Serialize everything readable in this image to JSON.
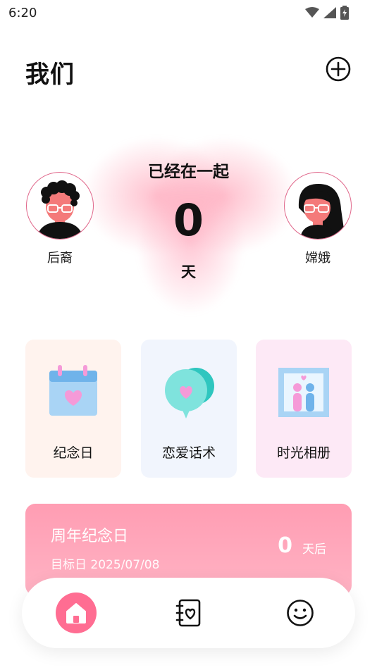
{
  "status_bar": {
    "time": "6:20"
  },
  "header": {
    "title": "我们"
  },
  "hero": {
    "together_label": "已经在一起",
    "days": "0",
    "unit": "天",
    "left_person": {
      "name": "后裔"
    },
    "right_person": {
      "name": "嫦娥"
    }
  },
  "features": [
    {
      "label": "纪念日",
      "icon": "calendar-heart-icon"
    },
    {
      "label": "恋爱话术",
      "icon": "chat-bubble-heart-icon"
    },
    {
      "label": "时光相册",
      "icon": "photo-album-icon"
    }
  ],
  "anniversary": {
    "title": "周年纪念日",
    "target_date": "目标日 2025/07/08",
    "days_left": "0",
    "unit": "天后"
  },
  "nav": [
    {
      "icon": "home-icon"
    },
    {
      "icon": "notebook-heart-icon"
    },
    {
      "icon": "smile-icon"
    }
  ],
  "colors": {
    "accent": "#ff6d92",
    "banner": "#ff9db3",
    "avatar_border": "#e0668a"
  }
}
